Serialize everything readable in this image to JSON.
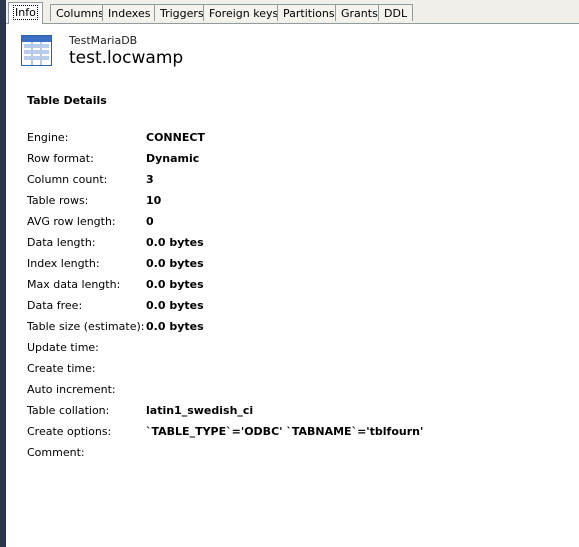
{
  "tabs": [
    {
      "label": "Info",
      "active": true
    },
    {
      "label": "Columns",
      "active": false
    },
    {
      "label": "Indexes",
      "active": false
    },
    {
      "label": "Triggers",
      "active": false
    },
    {
      "label": "Foreign keys",
      "active": false
    },
    {
      "label": "Partitions",
      "active": false
    },
    {
      "label": "Grants",
      "active": false
    },
    {
      "label": "DDL",
      "active": false
    }
  ],
  "header": {
    "icon": "table-icon",
    "schema": "TestMariaDB",
    "table": "test.locwamp"
  },
  "section": {
    "title": "Table Details"
  },
  "details": [
    {
      "label": "Engine:",
      "value": "CONNECT"
    },
    {
      "label": "Row format:",
      "value": "Dynamic"
    },
    {
      "label": "Column count:",
      "value": "3"
    },
    {
      "label": "Table rows:",
      "value": "10"
    },
    {
      "label": "AVG row length:",
      "value": "0"
    },
    {
      "label": "Data length:",
      "value": "0.0 bytes"
    },
    {
      "label": "Index length:",
      "value": "0.0 bytes"
    },
    {
      "label": "Max data length:",
      "value": "0.0 bytes"
    },
    {
      "label": "Data free:",
      "value": "0.0 bytes"
    },
    {
      "label": "Table size (estimate):",
      "value": "0.0 bytes"
    },
    {
      "label": "Update time:",
      "value": ""
    },
    {
      "label": "Create time:",
      "value": ""
    },
    {
      "label": "Auto increment:",
      "value": ""
    },
    {
      "label": "Table collation:",
      "value": "latin1_swedish_ci"
    },
    {
      "label": "Create options:",
      "value": "`TABLE_TYPE`='ODBC' `TABNAME`='tblfourn'"
    },
    {
      "label": "Comment:",
      "value": ""
    }
  ],
  "colors": {
    "tabstrip_bg": "#f0efe9",
    "tab_border": "#919b9c",
    "window_edge": "#29364c",
    "icon_blue": "#3a6fc4"
  }
}
